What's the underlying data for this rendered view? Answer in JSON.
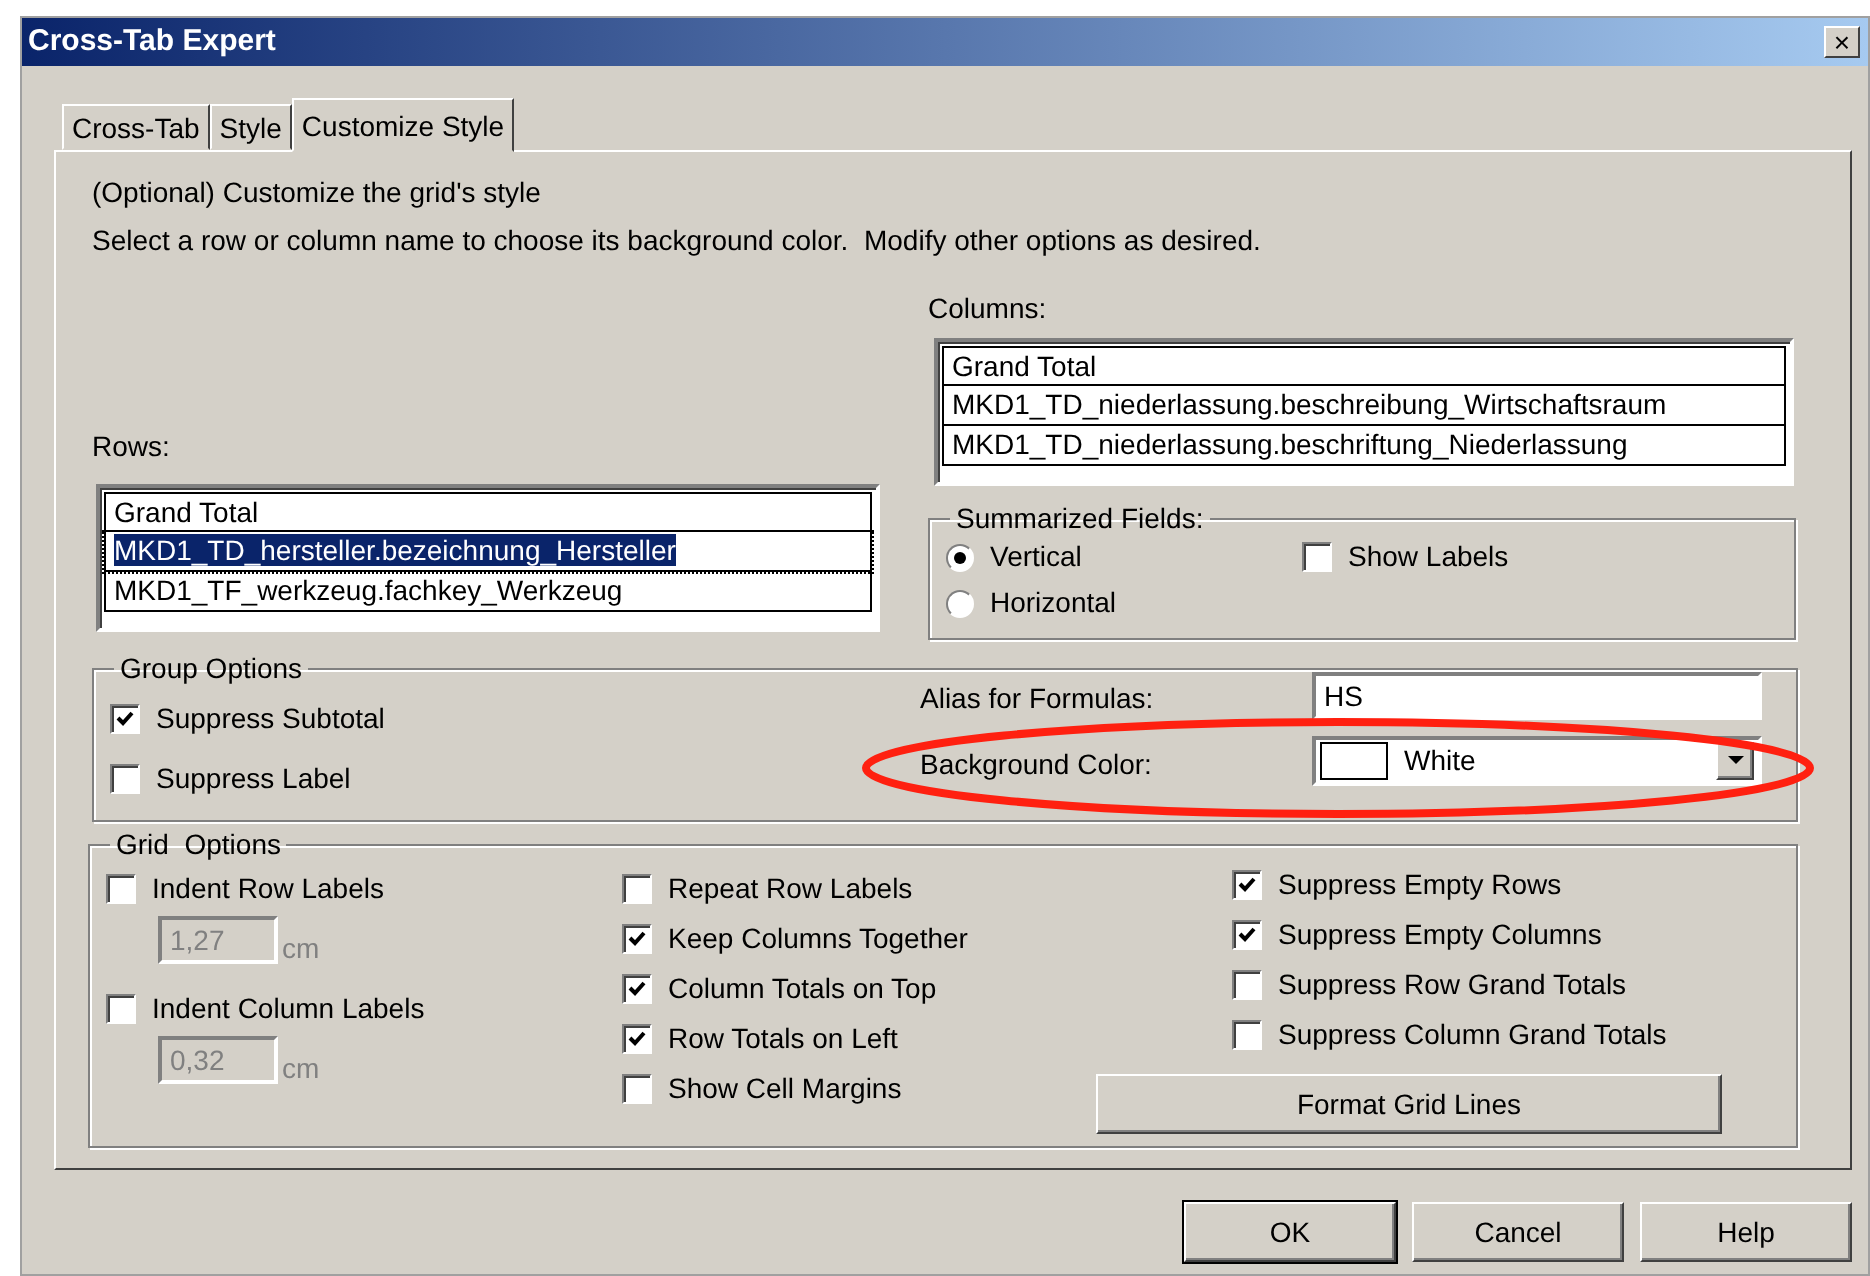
{
  "window": {
    "title": "Cross-Tab Expert",
    "close": "×"
  },
  "tabs": [
    {
      "label": "Cross-Tab",
      "selected": false
    },
    {
      "label": "Style",
      "selected": false
    },
    {
      "label": "Customize Style",
      "selected": true
    }
  ],
  "intro": [
    "(Optional) Customize the grid's style",
    "Select a row or column name to choose its background color.  Modify other options as desired."
  ],
  "columns": {
    "label": "Columns:",
    "items": [
      {
        "text": "Grand Total",
        "selected": false
      },
      {
        "text": "MKD1_TD_niederlassung.beschreibung_Wirtschaftsraum",
        "selected": false
      },
      {
        "text": "MKD1_TD_niederlassung.beschriftung_Niederlassung",
        "selected": false
      }
    ]
  },
  "rows": {
    "label": "Rows:",
    "items": [
      {
        "text": "Grand Total",
        "selected": false
      },
      {
        "text": "MKD1_TD_hersteller.bezeichnung_Hersteller",
        "selected": true
      },
      {
        "text": "MKD1_TF_werkzeug.fachkey_Werkzeug",
        "selected": false
      }
    ]
  },
  "summarized_fields": {
    "legend": "Summarized Fields:",
    "options": [
      {
        "label": "Vertical",
        "selected": true
      },
      {
        "label": "Horizontal",
        "selected": false
      }
    ],
    "show_labels": {
      "label": "Show Labels",
      "checked": false
    }
  },
  "group_options": {
    "legend": "Group Options",
    "checkboxes": [
      {
        "label": "Suppress Subtotal",
        "checked": true
      },
      {
        "label": "Suppress Label",
        "checked": false
      }
    ],
    "alias": {
      "label": "Alias for Formulas:",
      "value": "HS"
    },
    "background_color": {
      "label": "Background Color:",
      "value": "White"
    }
  },
  "grid_options": {
    "legend": "Grid  Options",
    "columns": [
      [
        {
          "kind": "checkbox",
          "label": "Indent Row Labels",
          "checked": false
        },
        {
          "kind": "measure",
          "value": "1,27",
          "unit": "cm",
          "disabled": true
        },
        {
          "kind": "checkbox",
          "label": "Indent Column Labels",
          "checked": false
        },
        {
          "kind": "measure",
          "value": "0,32",
          "unit": "cm",
          "disabled": true
        }
      ],
      [
        {
          "kind": "checkbox",
          "label": "Repeat Row Labels",
          "checked": false
        },
        {
          "kind": "checkbox",
          "label": "Keep Columns Together",
          "checked": true
        },
        {
          "kind": "checkbox",
          "label": "Column Totals on Top",
          "checked": true
        },
        {
          "kind": "checkbox",
          "label": "Row Totals on Left",
          "checked": true
        },
        {
          "kind": "checkbox",
          "label": "Show Cell Margins",
          "checked": false
        }
      ],
      [
        {
          "kind": "checkbox",
          "label": "Suppress Empty Rows",
          "checked": true
        },
        {
          "kind": "checkbox",
          "label": "Suppress Empty Columns",
          "checked": true
        },
        {
          "kind": "checkbox",
          "label": "Suppress Row Grand Totals",
          "checked": false
        },
        {
          "kind": "checkbox",
          "label": "Suppress Column Grand Totals",
          "checked": false
        },
        {
          "kind": "button",
          "label": "Format Grid Lines"
        }
      ]
    ]
  },
  "buttons": [
    {
      "label": "OK",
      "default": true
    },
    {
      "label": "Cancel",
      "default": false
    },
    {
      "label": "Help",
      "default": false
    }
  ]
}
